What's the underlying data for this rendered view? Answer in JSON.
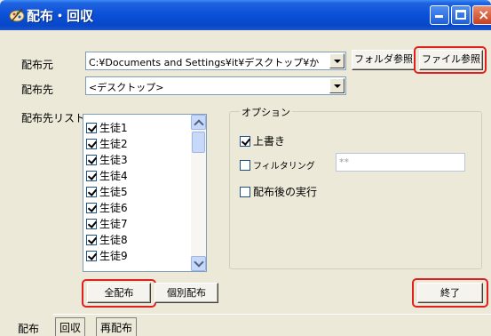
{
  "window": {
    "title": "配布・回収"
  },
  "source": {
    "label": "配布元",
    "path": "C:¥Documents and Settings¥it¥デスクトップ¥か",
    "folder_browse": "フォルダ参照",
    "file_browse": "ファイル参照"
  },
  "dest": {
    "label": "配布先",
    "value": "<デスクトップ>"
  },
  "list": {
    "label": "配布先リスト",
    "items": [
      {
        "label": "生徒1",
        "checked": true
      },
      {
        "label": "生徒2",
        "checked": true
      },
      {
        "label": "生徒3",
        "checked": true
      },
      {
        "label": "生徒4",
        "checked": true
      },
      {
        "label": "生徒5",
        "checked": true
      },
      {
        "label": "生徒6",
        "checked": true
      },
      {
        "label": "生徒7",
        "checked": true
      },
      {
        "label": "生徒8",
        "checked": true
      },
      {
        "label": "生徒9",
        "checked": true
      }
    ]
  },
  "options": {
    "legend": "オプション",
    "overwrite": {
      "label": "上書き",
      "checked": true
    },
    "filtering": {
      "label": "フィルタリング",
      "checked": false,
      "value": "**"
    },
    "run_after": {
      "label": "配布後の実行",
      "checked": false
    }
  },
  "buttons": {
    "distribute_all": "全配布",
    "distribute_each": "個別配布",
    "exit": "終了"
  },
  "tabs": [
    "配布",
    "回収",
    "再配布"
  ],
  "colors": {
    "highlight": "#E02020",
    "title_bar": "#0A4FD6"
  }
}
